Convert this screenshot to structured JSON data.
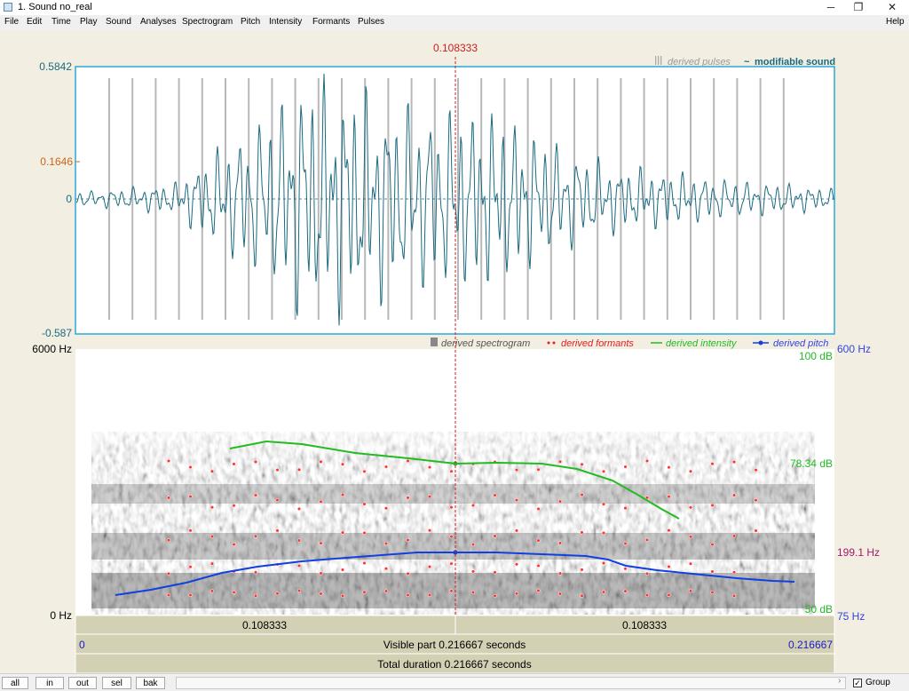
{
  "window": {
    "title": "1. Sound no_real",
    "min_icon": "minimize-icon",
    "max_icon": "maximize-icon",
    "close_icon": "close-icon"
  },
  "menu": [
    "File",
    "Edit",
    "Time",
    "Play",
    "Sound",
    "Analyses",
    "Spectrogram",
    "Pitch",
    "Intensity",
    "Formants",
    "Pulses"
  ],
  "menu_help": "Help",
  "cursor_time": "0.108333",
  "waveform": {
    "ymax": "0.5842",
    "ymid": "0.1646",
    "yzero": "0",
    "ymin": "-0.587",
    "legend_pulses": "derived pulses",
    "legend_sound": "modifiable sound"
  },
  "spectrogram": {
    "freq_top": "6000 Hz",
    "freq_bottom": "0 Hz",
    "legend_spectrogram": "derived spectrogram",
    "legend_formants": "derived formants",
    "legend_intensity": "derived intensity",
    "legend_pitch": "derived pitch",
    "intensity_top": "100 dB",
    "intensity_cursor": "78.34 dB",
    "intensity_bottom": "50 dB",
    "pitch_top": "600 Hz",
    "pitch_cursor": "199.1 Hz",
    "pitch_bottom": "75 Hz"
  },
  "timebar": {
    "left_segment": "0.108333",
    "right_segment": "0.108333",
    "start": "0",
    "end": "0.216667",
    "visible": "Visible part 0.216667 seconds",
    "total": "Total duration 0.216667 seconds"
  },
  "bottom": {
    "buttons": [
      "all",
      "in",
      "out",
      "sel",
      "bak"
    ],
    "group_label": "Group"
  },
  "colors": {
    "sound": "#1a6a80",
    "pulses": "#b8b8b8",
    "cursor": "#cc2020",
    "intensity": "#22bb22",
    "pitch": "#1040e0",
    "formants": "#e02020",
    "frame": "#2aaad8"
  }
}
